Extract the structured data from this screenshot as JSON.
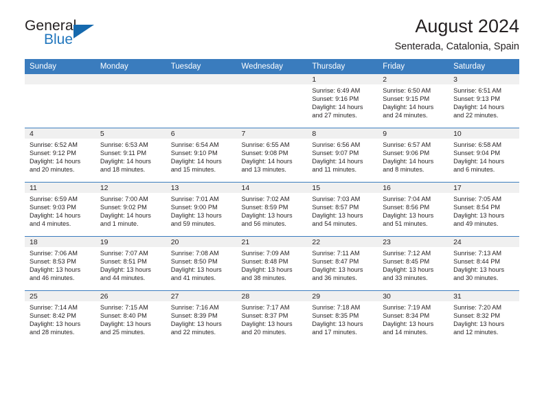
{
  "brand": {
    "name_top": "General",
    "name_bottom": "Blue",
    "mark": "triangle-logo",
    "accent_color": "#1569ae"
  },
  "header": {
    "title": "August 2024",
    "location": "Senterada, Catalonia, Spain"
  },
  "calendar": {
    "header_bg": "#3a7cbe",
    "daynum_bg": "#f0f0f0",
    "weekdays": [
      "Sunday",
      "Monday",
      "Tuesday",
      "Wednesday",
      "Thursday",
      "Friday",
      "Saturday"
    ],
    "weeks": [
      [
        {
          "empty": true
        },
        {
          "empty": true
        },
        {
          "empty": true
        },
        {
          "empty": true
        },
        {
          "day": "1",
          "sunrise": "Sunrise: 6:49 AM",
          "sunset": "Sunset: 9:16 PM",
          "daylight_1": "Daylight: 14 hours",
          "daylight_2": "and 27 minutes."
        },
        {
          "day": "2",
          "sunrise": "Sunrise: 6:50 AM",
          "sunset": "Sunset: 9:15 PM",
          "daylight_1": "Daylight: 14 hours",
          "daylight_2": "and 24 minutes."
        },
        {
          "day": "3",
          "sunrise": "Sunrise: 6:51 AM",
          "sunset": "Sunset: 9:13 PM",
          "daylight_1": "Daylight: 14 hours",
          "daylight_2": "and 22 minutes."
        }
      ],
      [
        {
          "day": "4",
          "sunrise": "Sunrise: 6:52 AM",
          "sunset": "Sunset: 9:12 PM",
          "daylight_1": "Daylight: 14 hours",
          "daylight_2": "and 20 minutes."
        },
        {
          "day": "5",
          "sunrise": "Sunrise: 6:53 AM",
          "sunset": "Sunset: 9:11 PM",
          "daylight_1": "Daylight: 14 hours",
          "daylight_2": "and 18 minutes."
        },
        {
          "day": "6",
          "sunrise": "Sunrise: 6:54 AM",
          "sunset": "Sunset: 9:10 PM",
          "daylight_1": "Daylight: 14 hours",
          "daylight_2": "and 15 minutes."
        },
        {
          "day": "7",
          "sunrise": "Sunrise: 6:55 AM",
          "sunset": "Sunset: 9:08 PM",
          "daylight_1": "Daylight: 14 hours",
          "daylight_2": "and 13 minutes."
        },
        {
          "day": "8",
          "sunrise": "Sunrise: 6:56 AM",
          "sunset": "Sunset: 9:07 PM",
          "daylight_1": "Daylight: 14 hours",
          "daylight_2": "and 11 minutes."
        },
        {
          "day": "9",
          "sunrise": "Sunrise: 6:57 AM",
          "sunset": "Sunset: 9:06 PM",
          "daylight_1": "Daylight: 14 hours",
          "daylight_2": "and 8 minutes."
        },
        {
          "day": "10",
          "sunrise": "Sunrise: 6:58 AM",
          "sunset": "Sunset: 9:04 PM",
          "daylight_1": "Daylight: 14 hours",
          "daylight_2": "and 6 minutes."
        }
      ],
      [
        {
          "day": "11",
          "sunrise": "Sunrise: 6:59 AM",
          "sunset": "Sunset: 9:03 PM",
          "daylight_1": "Daylight: 14 hours",
          "daylight_2": "and 4 minutes."
        },
        {
          "day": "12",
          "sunrise": "Sunrise: 7:00 AM",
          "sunset": "Sunset: 9:02 PM",
          "daylight_1": "Daylight: 14 hours",
          "daylight_2": "and 1 minute."
        },
        {
          "day": "13",
          "sunrise": "Sunrise: 7:01 AM",
          "sunset": "Sunset: 9:00 PM",
          "daylight_1": "Daylight: 13 hours",
          "daylight_2": "and 59 minutes."
        },
        {
          "day": "14",
          "sunrise": "Sunrise: 7:02 AM",
          "sunset": "Sunset: 8:59 PM",
          "daylight_1": "Daylight: 13 hours",
          "daylight_2": "and 56 minutes."
        },
        {
          "day": "15",
          "sunrise": "Sunrise: 7:03 AM",
          "sunset": "Sunset: 8:57 PM",
          "daylight_1": "Daylight: 13 hours",
          "daylight_2": "and 54 minutes."
        },
        {
          "day": "16",
          "sunrise": "Sunrise: 7:04 AM",
          "sunset": "Sunset: 8:56 PM",
          "daylight_1": "Daylight: 13 hours",
          "daylight_2": "and 51 minutes."
        },
        {
          "day": "17",
          "sunrise": "Sunrise: 7:05 AM",
          "sunset": "Sunset: 8:54 PM",
          "daylight_1": "Daylight: 13 hours",
          "daylight_2": "and 49 minutes."
        }
      ],
      [
        {
          "day": "18",
          "sunrise": "Sunrise: 7:06 AM",
          "sunset": "Sunset: 8:53 PM",
          "daylight_1": "Daylight: 13 hours",
          "daylight_2": "and 46 minutes."
        },
        {
          "day": "19",
          "sunrise": "Sunrise: 7:07 AM",
          "sunset": "Sunset: 8:51 PM",
          "daylight_1": "Daylight: 13 hours",
          "daylight_2": "and 44 minutes."
        },
        {
          "day": "20",
          "sunrise": "Sunrise: 7:08 AM",
          "sunset": "Sunset: 8:50 PM",
          "daylight_1": "Daylight: 13 hours",
          "daylight_2": "and 41 minutes."
        },
        {
          "day": "21",
          "sunrise": "Sunrise: 7:09 AM",
          "sunset": "Sunset: 8:48 PM",
          "daylight_1": "Daylight: 13 hours",
          "daylight_2": "and 38 minutes."
        },
        {
          "day": "22",
          "sunrise": "Sunrise: 7:11 AM",
          "sunset": "Sunset: 8:47 PM",
          "daylight_1": "Daylight: 13 hours",
          "daylight_2": "and 36 minutes."
        },
        {
          "day": "23",
          "sunrise": "Sunrise: 7:12 AM",
          "sunset": "Sunset: 8:45 PM",
          "daylight_1": "Daylight: 13 hours",
          "daylight_2": "and 33 minutes."
        },
        {
          "day": "24",
          "sunrise": "Sunrise: 7:13 AM",
          "sunset": "Sunset: 8:44 PM",
          "daylight_1": "Daylight: 13 hours",
          "daylight_2": "and 30 minutes."
        }
      ],
      [
        {
          "day": "25",
          "sunrise": "Sunrise: 7:14 AM",
          "sunset": "Sunset: 8:42 PM",
          "daylight_1": "Daylight: 13 hours",
          "daylight_2": "and 28 minutes."
        },
        {
          "day": "26",
          "sunrise": "Sunrise: 7:15 AM",
          "sunset": "Sunset: 8:40 PM",
          "daylight_1": "Daylight: 13 hours",
          "daylight_2": "and 25 minutes."
        },
        {
          "day": "27",
          "sunrise": "Sunrise: 7:16 AM",
          "sunset": "Sunset: 8:39 PM",
          "daylight_1": "Daylight: 13 hours",
          "daylight_2": "and 22 minutes."
        },
        {
          "day": "28",
          "sunrise": "Sunrise: 7:17 AM",
          "sunset": "Sunset: 8:37 PM",
          "daylight_1": "Daylight: 13 hours",
          "daylight_2": "and 20 minutes."
        },
        {
          "day": "29",
          "sunrise": "Sunrise: 7:18 AM",
          "sunset": "Sunset: 8:35 PM",
          "daylight_1": "Daylight: 13 hours",
          "daylight_2": "and 17 minutes."
        },
        {
          "day": "30",
          "sunrise": "Sunrise: 7:19 AM",
          "sunset": "Sunset: 8:34 PM",
          "daylight_1": "Daylight: 13 hours",
          "daylight_2": "and 14 minutes."
        },
        {
          "day": "31",
          "sunrise": "Sunrise: 7:20 AM",
          "sunset": "Sunset: 8:32 PM",
          "daylight_1": "Daylight: 13 hours",
          "daylight_2": "and 12 minutes."
        }
      ]
    ]
  }
}
